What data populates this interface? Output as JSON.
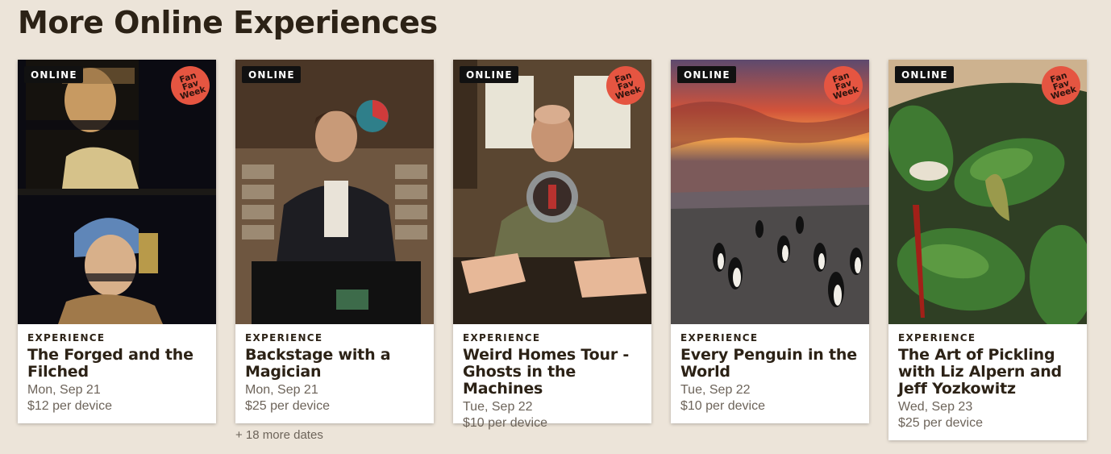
{
  "section": {
    "title": "More Online Experiences"
  },
  "colors": {
    "background": "#ece4d9",
    "fan_badge": "#e55541",
    "online_badge": "#111111"
  },
  "cards": [
    {
      "badge": "ONLINE",
      "fan_badge": "Fan\nFav\nWeek",
      "kicker": "EXPERIENCE",
      "title": "The Forged and the Filched",
      "date": "Mon, Sep 21",
      "price": "$12 per device"
    },
    {
      "badge": "ONLINE",
      "kicker": "EXPERIENCE",
      "title": "Backstage with a Magician",
      "date": "Mon, Sep 21",
      "price": "$25 per device",
      "more_dates": "+ 18 more dates"
    },
    {
      "badge": "ONLINE",
      "fan_badge": "Fan\nFav\nWeek",
      "kicker": "EXPERIENCE",
      "title": "Weird Homes Tour - Ghosts in the Machines",
      "date": "Tue, Sep 22",
      "price": "$10 per device"
    },
    {
      "badge": "ONLINE",
      "fan_badge": "Fan\nFav\nWeek",
      "kicker": "EXPERIENCE",
      "title": "Every Penguin in the World",
      "date": "Tue, Sep 22",
      "price": "$10 per device"
    },
    {
      "badge": "ONLINE",
      "fan_badge": "Fan\nFav\nWeek",
      "kicker": "EXPERIENCE",
      "title": "The Art of Pickling with Liz Alpern and Jeff Yozkowitz",
      "date": "Wed, Sep 23",
      "price": "$25 per device"
    }
  ]
}
